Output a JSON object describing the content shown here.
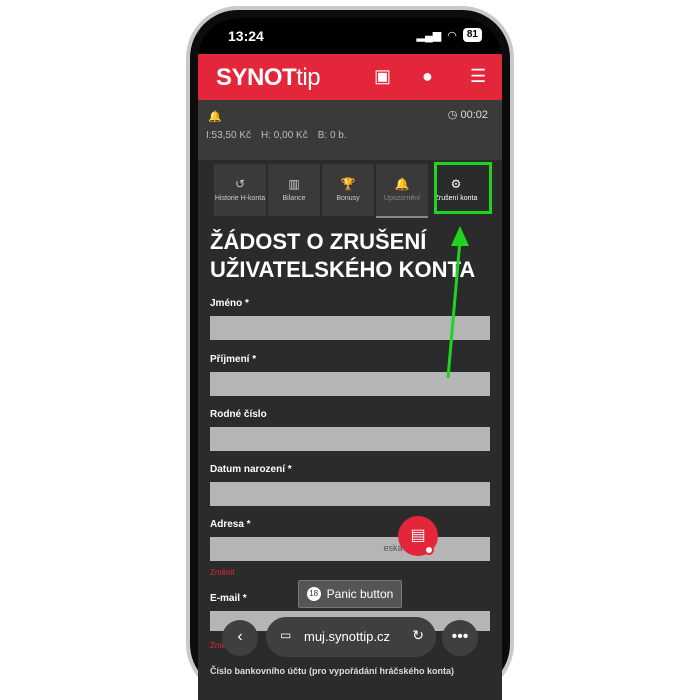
{
  "status": {
    "time": "13:24",
    "battery": "81"
  },
  "app": {
    "logo_main": "SYNOT",
    "logo_sub": "tip"
  },
  "subheader": {
    "timer": "00:02",
    "balances": [
      "I:53,50 Kč",
      "H: 0,00 Kč",
      "B: 0 b."
    ]
  },
  "tabs": [
    {
      "icon": "↺",
      "label": "Historie H-konta"
    },
    {
      "icon": "▥",
      "label": "Bilance"
    },
    {
      "icon": "🏆",
      "label": "Bonusy"
    },
    {
      "icon": "🔔",
      "label": "Upozornění"
    },
    {
      "icon": "⚙",
      "label": "Zrušení konta"
    }
  ],
  "form": {
    "title": "ŽÁDOST O ZRUŠENÍ UŽIVATELSKÉHO KONTA",
    "labels": {
      "name": "Jméno *",
      "surname": "Příjmení *",
      "id": "Rodné číslo",
      "dob": "Datum narození *",
      "address": "Adresa *",
      "email": "E-mail *"
    },
    "address_value": "eská republ",
    "change": "Změnit",
    "change2": "Změnit",
    "bank_label": "Číslo bankovního účtu (pro vypořádání hráčského konta)"
  },
  "panic": {
    "label": "Panic button",
    "icon": "18"
  },
  "browser": {
    "url": "muj.synottip.cz"
  }
}
